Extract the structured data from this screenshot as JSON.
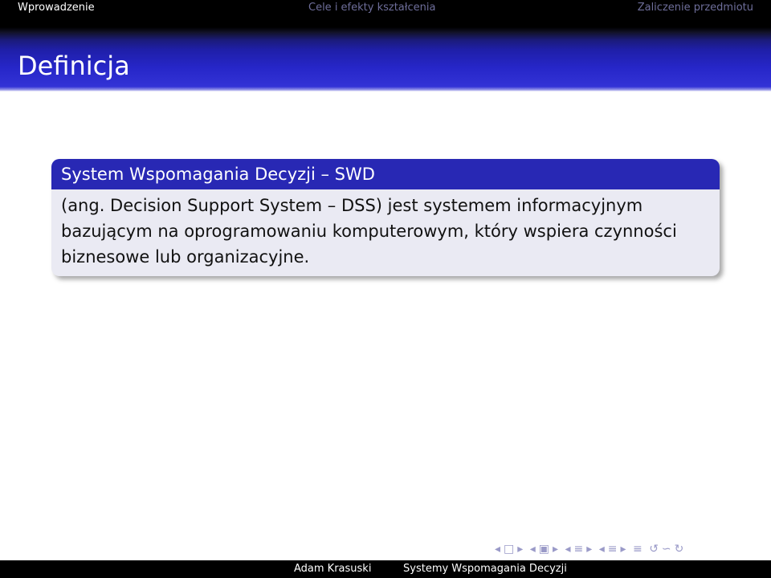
{
  "nav": {
    "sections": [
      "Wprowadzenie",
      "Cele i efekty kształcenia",
      "Zaliczenie przedmiotu"
    ],
    "active": "Wprowadzenie"
  },
  "frame": {
    "title": "Definicja"
  },
  "block": {
    "title": "System Wspomagania Decyzji – SWD",
    "lines": [
      "(ang. Decision Support System – DSS) jest systemem informacyjnym",
      "bazującym na oprogramowaniu komputerowym, który wspiera czynności",
      "biznesowe lub organizacyjne."
    ]
  },
  "navsymbols": [
    "◂",
    "□",
    "▸",
    "◂",
    "▣",
    "▸",
    "◂",
    "≡",
    "▸",
    "◂",
    "≡",
    "▸",
    "≡",
    "↺",
    "∽",
    "↻"
  ],
  "footer": {
    "author": "Adam Krasuski",
    "short_title": "Systemy Wspomagania Decyzji"
  },
  "colors": {
    "block_title_bg": "#2828b4",
    "block_body_bg": "#eaeaf3",
    "title_band": "#2626c8"
  }
}
